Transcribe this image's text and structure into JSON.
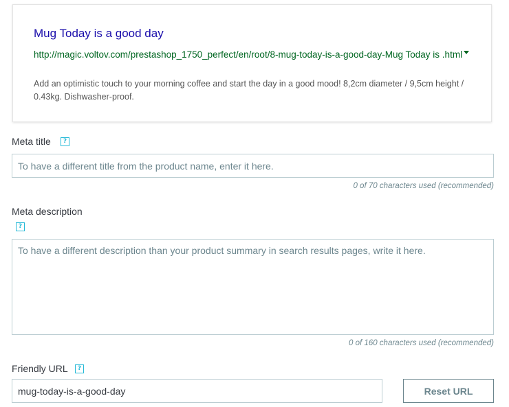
{
  "preview": {
    "title": "Mug Today is a good day",
    "url": "http://magic.voltov.com/prestashop_1750_perfect/en/root/8-mug-today-is-a-good-day-Mug Today is .html",
    "description": "Add an optimistic touch to your morning coffee and start the day in a good mood! 8,2cm diameter / 9,5cm height / 0.43kg. Dishwasher-proof."
  },
  "meta_title": {
    "label": "Meta title",
    "help": "?",
    "placeholder": "To have a different title from the product name, enter it here.",
    "value": "",
    "counter": "0 of 70 characters used (recommended)"
  },
  "meta_description": {
    "label": "Meta description",
    "help": "?",
    "placeholder": "To have a different description than your product summary in search results pages, write it here.",
    "value": "",
    "counter": "0 of 160 characters used (recommended)"
  },
  "friendly_url": {
    "label": "Friendly URL",
    "help": "?",
    "value": "mug-today-is-a-good-day",
    "reset_label": "Reset URL"
  },
  "colors": {
    "link_title": "#1a0dab",
    "link_url": "#006621",
    "help_accent": "#25b9d7",
    "input_border": "#bbcdd2"
  }
}
